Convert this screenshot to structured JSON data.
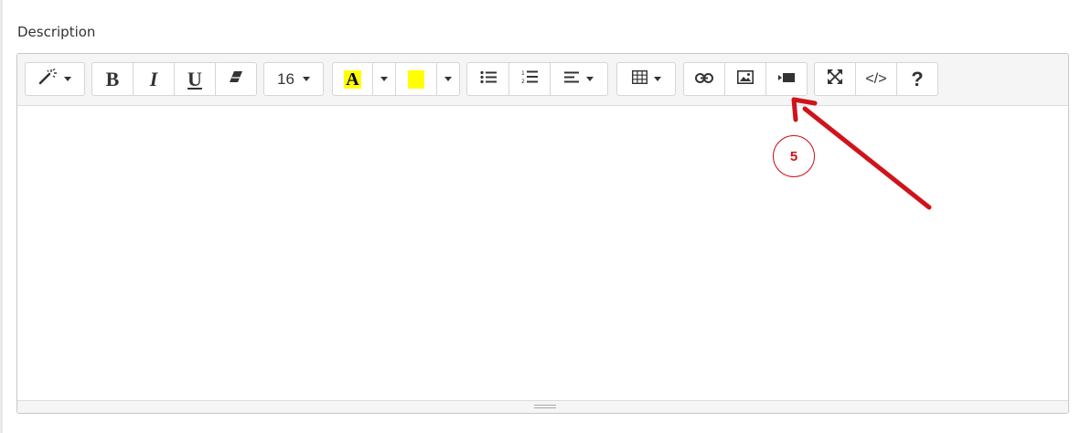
{
  "field": {
    "label": "Description"
  },
  "toolbar": {
    "font_size_value": "16",
    "fore_color_letter": "A",
    "code_view_label": "</>",
    "help_label": "?"
  },
  "annotation": {
    "step_number": "5"
  },
  "colors": {
    "fore_highlight": "#ffff00",
    "back_color_swatch": "#ffff00",
    "annotation_red": "#d0131a"
  },
  "icons": {
    "style": "magic-wand-icon",
    "eraser": "eraser-icon",
    "unordered_list": "unordered-list-icon",
    "ordered_list": "ordered-list-icon",
    "align": "align-left-icon",
    "table": "table-icon",
    "link": "link-icon",
    "picture": "picture-icon",
    "video": "video-icon",
    "fullscreen": "fullscreen-icon"
  }
}
